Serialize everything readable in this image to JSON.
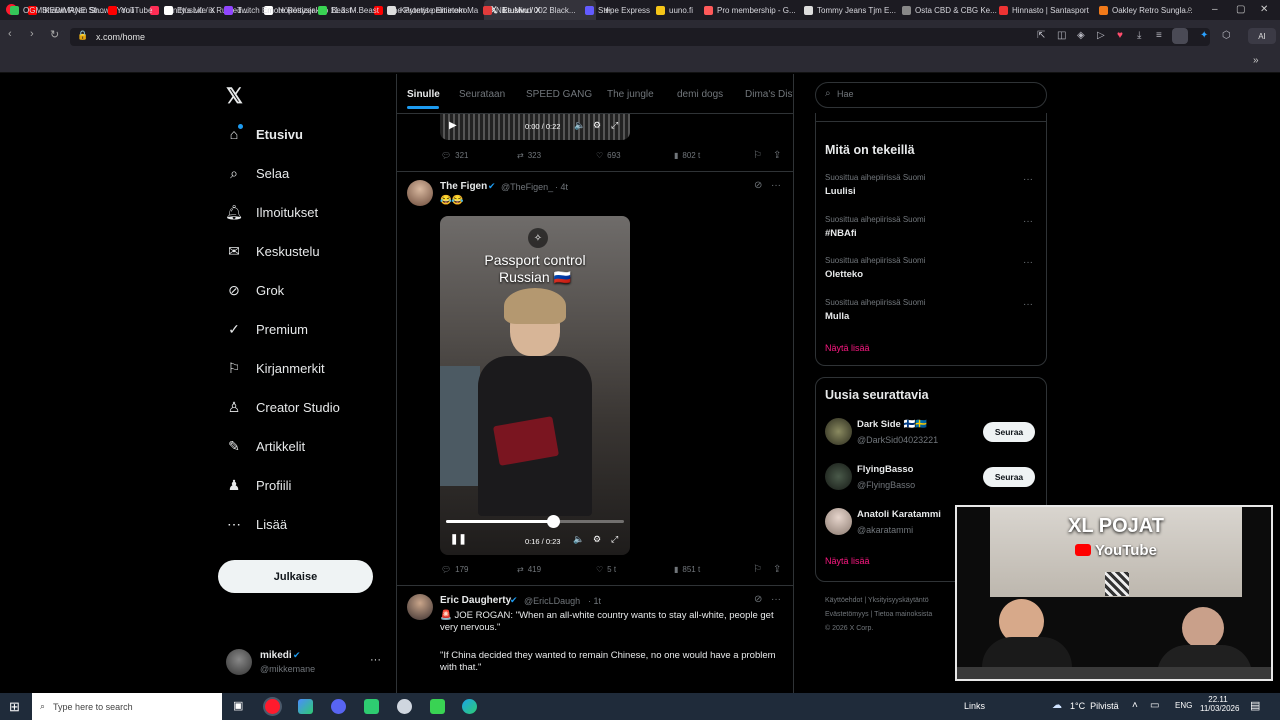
{
  "browser": {
    "tabs": [
      {
        "title": "Shawn Ryan Show - YouTu",
        "color": "#ff0000"
      },
      {
        "title": "Alinity's Life is Ruined...",
        "color": "#ff2d55"
      },
      {
        "title": "Höpöttysjakso 11.3. M...",
        "color": "#ffffff"
      },
      {
        "title": "The Promise Eminem Ma",
        "color": "#ff0000"
      },
      {
        "title": "Etusivu / X",
        "color": "#ffffff"
      }
    ],
    "url": "x.com/home",
    "bookmarks": [
      "OGMIKEDIMANE Str...",
      "YouTube",
      "Etusivu / X",
      "Twitch Emote Resizer",
      "Beast - Beast",
      "Käytetyt pelitietoko...",
      "Nike Mind 002 Black...",
      "Stripe Express",
      "uuno.fi",
      "Pro membership - G...",
      "Tommy Jeans Tjm E...",
      "Osta CBD & CBG Ke...",
      "Hinnasto | Santasport",
      "Oakley Retro Sungla..."
    ]
  },
  "sidebar": {
    "items": [
      {
        "label": "Etusivu",
        "icon": "home-icon"
      },
      {
        "label": "Selaa",
        "icon": "search-icon"
      },
      {
        "label": "Ilmoitukset",
        "icon": "bell-icon"
      },
      {
        "label": "Keskustelu",
        "icon": "mail-icon"
      },
      {
        "label": "Grok",
        "icon": "grok-icon"
      },
      {
        "label": "Premium",
        "icon": "verified-icon"
      },
      {
        "label": "Kirjanmerkit",
        "icon": "bookmark-icon"
      },
      {
        "label": "Creator Studio",
        "icon": "creator-icon"
      },
      {
        "label": "Artikkelit",
        "icon": "article-icon"
      },
      {
        "label": "Profiili",
        "icon": "person-icon"
      },
      {
        "label": "Lisää",
        "icon": "more-icon"
      }
    ],
    "post_label": "Julkaise",
    "account": {
      "name": "mikedi",
      "handle": "@mikkemane"
    }
  },
  "feed": {
    "tabs": [
      "Sinulle",
      "Seurataan",
      "SPEED GANG",
      "The jungle",
      "demi dogs",
      "Dima's Dist"
    ],
    "prev_tweet": {
      "video_time": "0:00 / 0:22",
      "replies": "321",
      "reposts": "323",
      "likes": "693",
      "views": "802 t"
    },
    "tweet1": {
      "name": "The Figen",
      "handle": "@TheFigen_",
      "time": "· 4t",
      "text": "😂😂",
      "video_caption_1": "Passport control",
      "video_caption_2": "Russian 🇷🇺",
      "video_time": "0:16 / 0:23",
      "progress": 0.6,
      "replies": "179",
      "reposts": "419",
      "likes": "5 t",
      "views": "851 t"
    },
    "tweet2": {
      "name": "Eric Daugherty",
      "handle": "@EricLDaugh",
      "time": "· 1t",
      "line1": "🚨 JOE ROGAN: \"When an all-white country wants to stay all-white, people get very nervous.\"",
      "line2": "\"If China decided they wanted to remain Chinese, no one would have a problem with that.\""
    }
  },
  "right": {
    "search_placeholder": "Hae",
    "trends_title": "Mitä on tekeillä",
    "trends": [
      {
        "context": "Suosittua aihepiirissä Suomi",
        "name": "Luulisi"
      },
      {
        "context": "Suosittua aihepiirissä Suomi",
        "name": "#NBAfi"
      },
      {
        "context": "Suosittua aihepiirissä Suomi",
        "name": "Oletteko"
      },
      {
        "context": "Suosittua aihepiirissä Suomi",
        "name": "Mulla"
      }
    ],
    "show_more": "Näytä lisää",
    "follow_title": "Uusia seurattavia",
    "follow": [
      {
        "name": "Dark Side 🇫🇮🇸🇪",
        "handle": "@DarkSid04023221",
        "button": "Seuraa"
      },
      {
        "name": "FlyingBasso",
        "handle": "@FlyingBasso",
        "button": "Seuraa"
      },
      {
        "name": "Anatoli Karatammi",
        "handle": "@akaratammi",
        "button": ""
      }
    ],
    "show_more_2": "Näytä lisää",
    "footer": [
      "Käyttöehdot",
      "Yksityisyyskäytäntö",
      "Evästeitä",
      "Evästetömyys",
      "Tietoa mainoksista",
      "© 2026 X Corp."
    ]
  },
  "overlay": {
    "title": "XL POJAT",
    "platform": "YouTube"
  },
  "taskbar": {
    "search_placeholder": "Type here to search",
    "links": "Links",
    "weather": "1°C  Pilvistä",
    "lang": "ENG",
    "time": "22.11",
    "date": "11/03/2026"
  },
  "colors": {
    "accent": "#1d9bf0",
    "link": "#f91880",
    "brand_red": "#ff0000"
  }
}
